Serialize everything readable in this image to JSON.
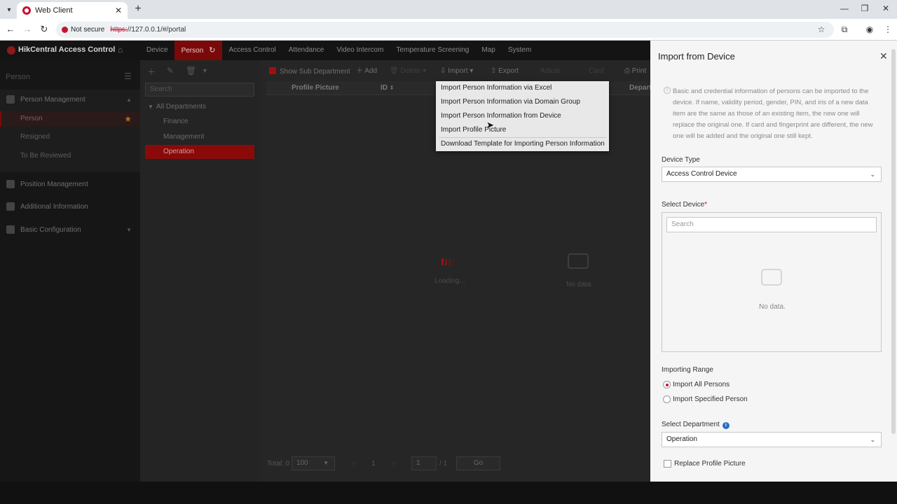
{
  "browser": {
    "tab_title": "Web Client",
    "security_label": "Not secure",
    "url_scheme": "https:",
    "url_rest": "//127.0.0.1/#/portal"
  },
  "app": {
    "brand": "HikCentral Access Control",
    "menu": [
      "Device",
      "Person",
      "Access Control",
      "Attendance",
      "Video Intercom",
      "Temperature Screening",
      "Map",
      "System"
    ],
    "active_menu": "Person"
  },
  "sidebar": {
    "title": "Person",
    "sections": {
      "person_management": "Person Management",
      "position_management": "Position Management",
      "additional_information": "Additional Information",
      "basic_configuration": "Basic Configuration"
    },
    "items": [
      "Person",
      "Resigned",
      "To Be Reviewed"
    ]
  },
  "departments": {
    "search_placeholder": "Search",
    "root": "All Departments",
    "children": [
      "Finance",
      "Management",
      "Operation"
    ],
    "selected": "Operation"
  },
  "toolbar": {
    "show_sub_department": "Show Sub Department",
    "add": "Add",
    "delete": "Delete",
    "import": "Import",
    "export": "Export",
    "adjust": "Adjust",
    "card": "Card",
    "print": "Print"
  },
  "table": {
    "columns": [
      "Profile Picture",
      "ID",
      "Depart"
    ],
    "loading": "Loading...",
    "no_data": "No data."
  },
  "import_menu": {
    "items": [
      "Import Person Information via Excel",
      "Import Person Information via Domain Group",
      "Import Person Information from Device",
      "Import Profile Picture",
      "Download Template for Importing Person Information"
    ]
  },
  "pager": {
    "total": "Total: 0",
    "page_size": "100",
    "current_page": "1",
    "page_input": "1",
    "total_pages": "/ 1",
    "go": "Go"
  },
  "import_panel": {
    "title": "Import from Device",
    "info": "Basic and credential information of persons can be imported to the device. If name, validity period, gender, PIN, and iris of a new data item are the same as those of an existing item, the new one will replace the original one. If card and fingerprint are different, the new one will be added and the original one still kept.",
    "device_type_label": "Device Type",
    "device_type_value": "Access Control Device",
    "select_device_label": "Select Device",
    "required_mark": "*",
    "device_search_placeholder": "Search",
    "no_data": "No data.",
    "importing_range_label": "Importing Range",
    "range_all": "Import All Persons",
    "range_specified": "Import Specified Person",
    "select_department_label": "Select Department",
    "department_value": "Operation",
    "replace_profile_picture": "Replace Profile Picture"
  },
  "colors": {
    "accent": "#c8102e",
    "active_menu_bg": "#7a0a0a",
    "info_blue": "#2b6fc2"
  }
}
